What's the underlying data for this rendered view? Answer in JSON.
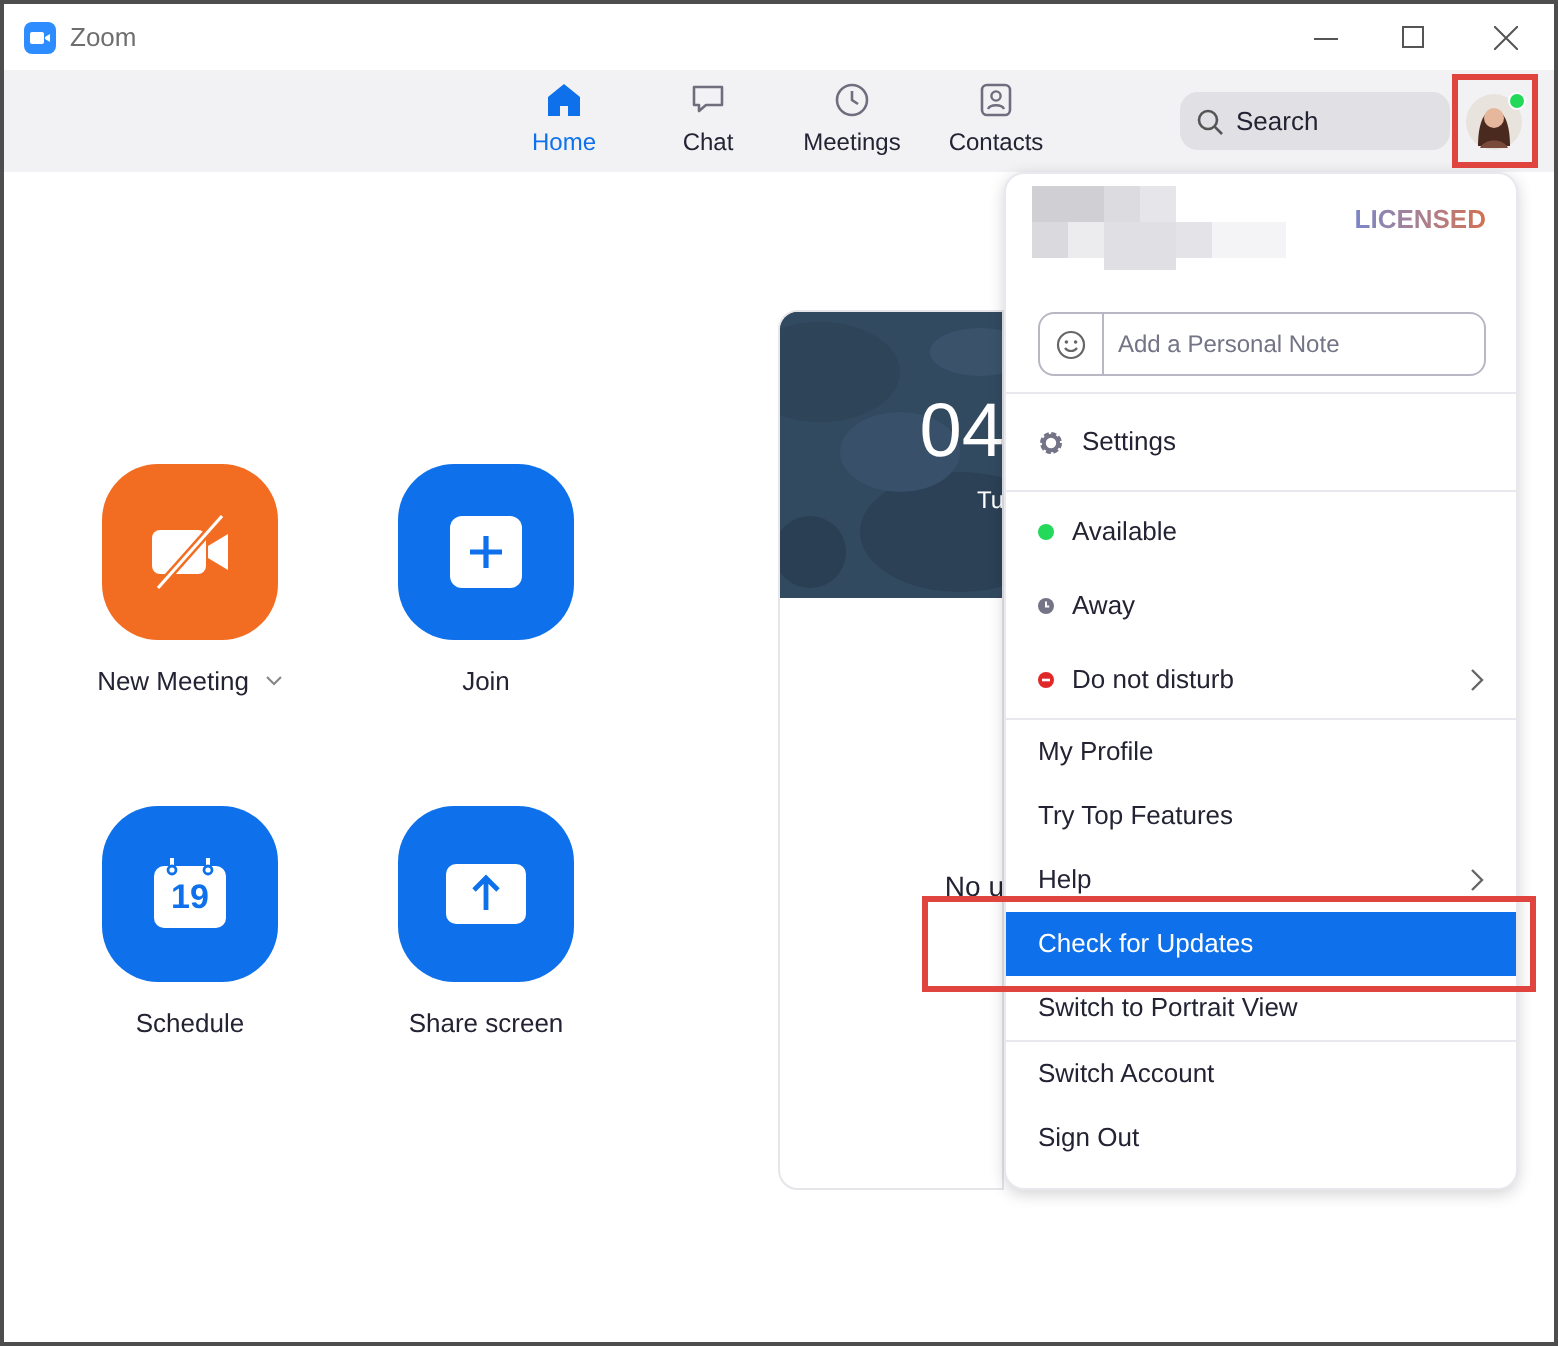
{
  "window": {
    "title": "Zoom"
  },
  "nav_tabs": [
    {
      "label": "Home",
      "kind": "home",
      "selected": true
    },
    {
      "label": "Chat",
      "kind": "chat",
      "selected": false
    },
    {
      "label": "Meetings",
      "kind": "clock",
      "selected": false
    },
    {
      "label": "Contacts",
      "kind": "contacts",
      "selected": false
    }
  ],
  "search": {
    "placeholder": "Search"
  },
  "profile": {
    "online": true,
    "highlighted": true
  },
  "actions": [
    {
      "label": "New Meeting",
      "kind": "video-off",
      "color": "#f26d21",
      "has_menu": true
    },
    {
      "label": "Join",
      "kind": "plus",
      "color": "#0e71eb",
      "has_menu": false
    },
    {
      "label": "Schedule",
      "kind": "calendar",
      "color": "#0e71eb",
      "has_menu": false,
      "day": "19"
    },
    {
      "label": "Share screen",
      "kind": "share",
      "color": "#0e71eb",
      "has_menu": false
    }
  ],
  "meeting_card": {
    "time": "04",
    "date": "Tu",
    "empty_text": "No u"
  },
  "menu": {
    "license": "LICENSED",
    "note_placeholder": "Add a Personal Note",
    "sections": [
      [
        {
          "label": "Settings",
          "kind": "gear",
          "submenu": false,
          "selected": false,
          "highlighted": false
        }
      ],
      [
        {
          "label": "Available",
          "kind": "dot",
          "color": "#23d959",
          "submenu": false,
          "selected": false,
          "highlighted": false
        },
        {
          "label": "Away",
          "kind": "clock",
          "color": "#747487",
          "submenu": false,
          "selected": false,
          "highlighted": false
        },
        {
          "label": "Do not disturb",
          "kind": "minus",
          "color": "#e02828",
          "submenu": true,
          "selected": false,
          "highlighted": false
        }
      ],
      [
        {
          "label": "My Profile",
          "kind": "plain",
          "submenu": false,
          "selected": false,
          "highlighted": false
        },
        {
          "label": "Try Top Features",
          "kind": "plain",
          "submenu": false,
          "selected": false,
          "highlighted": false
        },
        {
          "label": "Help",
          "kind": "plain",
          "submenu": true,
          "selected": false,
          "highlighted": false
        },
        {
          "label": "Check for Updates",
          "kind": "plain",
          "submenu": false,
          "selected": true,
          "highlighted": true
        },
        {
          "label": "Switch to Portrait View",
          "kind": "plain",
          "submenu": false,
          "selected": false,
          "highlighted": false
        }
      ],
      [
        {
          "label": "Switch Account",
          "kind": "plain",
          "submenu": false,
          "selected": false,
          "highlighted": false
        },
        {
          "label": "Sign Out",
          "kind": "plain",
          "submenu": false,
          "selected": false,
          "highlighted": false
        }
      ]
    ]
  }
}
